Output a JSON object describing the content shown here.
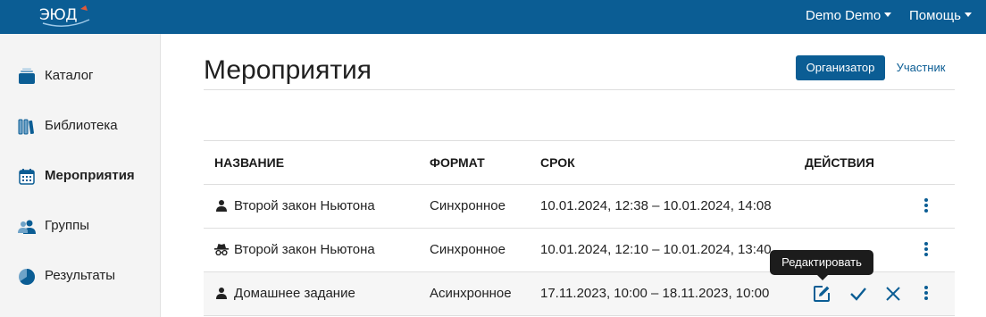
{
  "header": {
    "logo_text": "ЭЮД",
    "user_menu": "Demo Demo",
    "help_menu": "Помощь"
  },
  "sidebar": {
    "items": [
      {
        "label": "Каталог",
        "icon": "catalog-icon"
      },
      {
        "label": "Библиотека",
        "icon": "library-icon"
      },
      {
        "label": "Мероприятия",
        "icon": "calendar-icon",
        "active": true
      },
      {
        "label": "Группы",
        "icon": "group-icon"
      },
      {
        "label": "Результаты",
        "icon": "pie-chart-icon"
      }
    ]
  },
  "main": {
    "title": "Мероприятия",
    "role_tabs": {
      "organizer": "Организатор",
      "participant": "Участник"
    }
  },
  "table": {
    "columns": [
      "НАЗВАНИЕ",
      "ФОРМАТ",
      "СРОК",
      "ДЕЙСТВИЯ"
    ],
    "rows": [
      {
        "icon": "person-icon",
        "name": "Второй закон Ньютона",
        "format": "Синхронное",
        "term": "10.01.2024, 12:38 – 10.01.2024, 14:08"
      },
      {
        "icon": "incognito-icon",
        "name": "Второй закон Ньютона",
        "format": "Синхронное",
        "term": "10.01.2024, 12:10 – 10.01.2024, 13:40"
      },
      {
        "icon": "person-icon",
        "name": "Домашнее задание",
        "format": "Асинхронное",
        "term": "17.11.2023, 10:00 – 18.11.2023, 10:00"
      }
    ]
  },
  "tooltip": "Редактировать",
  "colors": {
    "brand": "#0b5d94",
    "sidebar_bg": "#f4f4f4"
  }
}
